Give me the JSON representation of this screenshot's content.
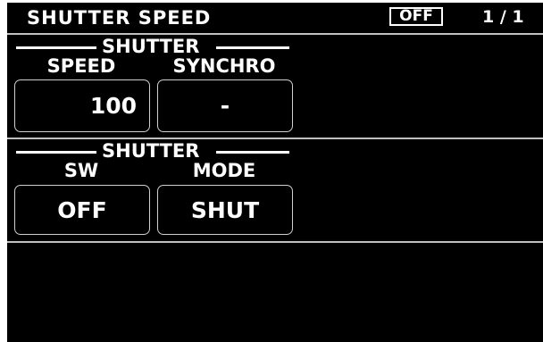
{
  "header": {
    "title": "SHUTTER SPEED",
    "status_badge": "OFF",
    "page_indicator": "1 / 1"
  },
  "sections": [
    {
      "group_title": "SHUTTER",
      "fields": [
        {
          "label": "SPEED",
          "value": "100"
        },
        {
          "label": "SYNCHRO",
          "value": "-"
        }
      ]
    },
    {
      "group_title": "SHUTTER",
      "fields": [
        {
          "label": "SW",
          "value": "OFF"
        },
        {
          "label": "MODE",
          "value": "SHUT"
        }
      ]
    }
  ],
  "colors": {
    "background": "#000000",
    "text": "#ffffff",
    "divider": "#bfbfbf"
  }
}
